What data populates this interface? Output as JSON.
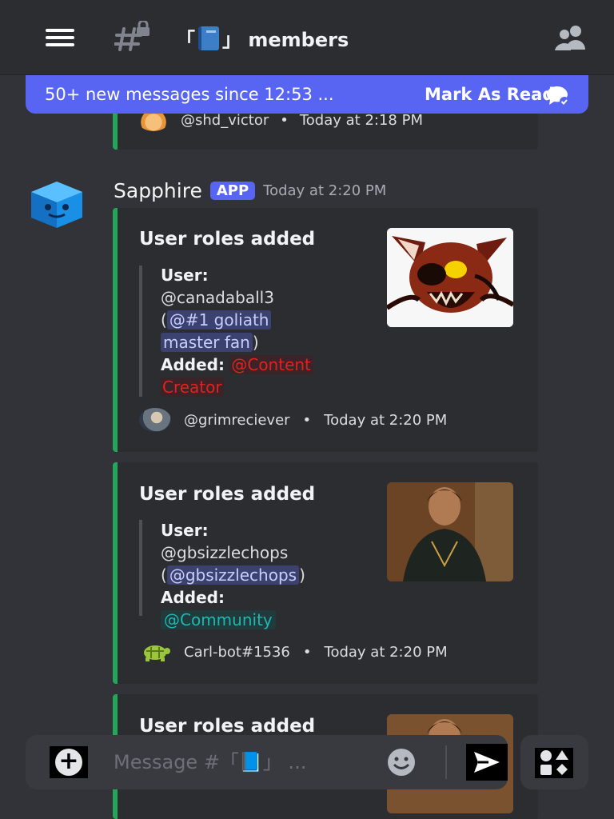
{
  "header": {
    "channel_title": "「📘」 members",
    "channel_prefix": "「",
    "channel_suffix": "」 members"
  },
  "banner": {
    "text": "50+ new messages since 12:53 ...",
    "mark_label": "Mark As Read"
  },
  "previous_embed": {
    "footer_author": "@shd_victor",
    "footer_sep": "•",
    "footer_time": "Today at 2:18 PM"
  },
  "message": {
    "author": "Sapphire",
    "badge": "APP",
    "time": "Today at 2:20 PM"
  },
  "embeds": [
    {
      "title": "User roles added",
      "user_label": "User:",
      "user_name": "@canadaball3",
      "open_paren": "(",
      "mention_line1": "@#1 goliath",
      "mention_line2": "master fan",
      "close_paren": ")",
      "added_label": "Added:",
      "role_line1": "@Content",
      "role_line2": "Creator",
      "footer_author": "@grimreciever",
      "footer_sep": "•",
      "footer_time": "Today at 2:20 PM"
    },
    {
      "title": "User roles added",
      "user_label": "User:",
      "user_name": "@gbsizzlechops",
      "open_paren": "(",
      "mention": "@gbsizzlechops",
      "close_paren": ")",
      "added_label": "Added:",
      "role": "@Community",
      "footer_author": "Carl-bot#1536",
      "footer_sep": "•",
      "footer_time": "Today at 2:20 PM"
    },
    {
      "title": "User roles added"
    }
  ],
  "composer": {
    "placeholder": "Message #「📘」 ..."
  },
  "colors": {
    "accent": "#5865f2",
    "embed_bar": "#23a55a",
    "role_content_creator": "#e32121",
    "role_community": "#1fb7b1"
  },
  "icons": [
    "hamburger-icon",
    "channel-thread-icon",
    "members-icon",
    "chat-check-icon",
    "plus-icon",
    "emoji-icon",
    "send-icon",
    "apps-icon"
  ]
}
